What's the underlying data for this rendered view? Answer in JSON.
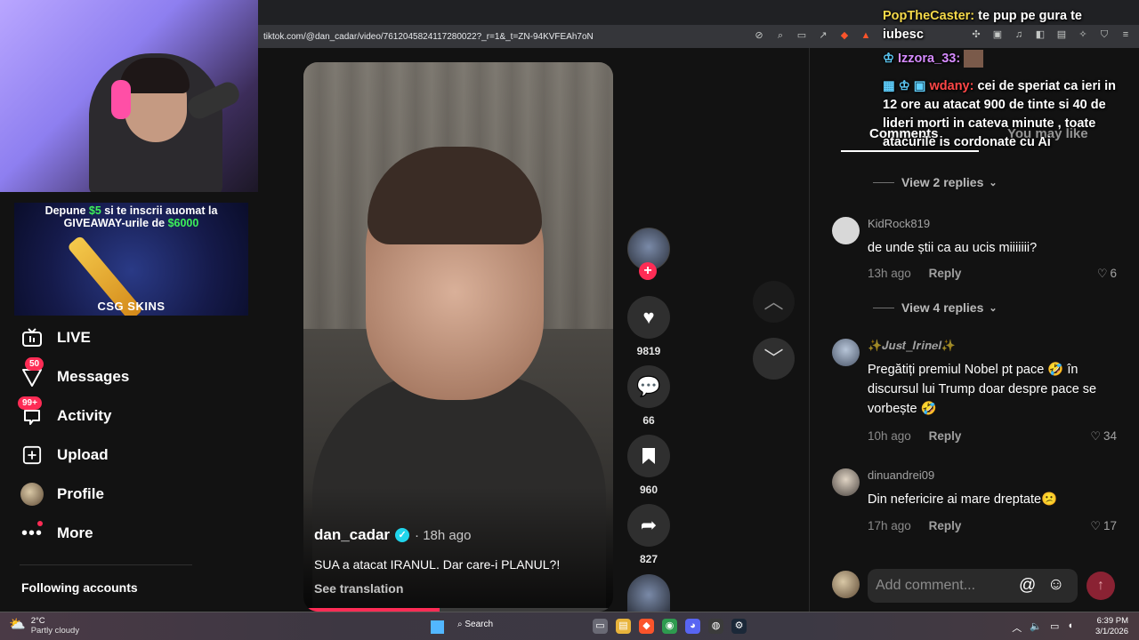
{
  "browser": {
    "url": "tiktok.com/@dan_cadar/video/7612045824117280022?_r=1&_t=ZN-94KVFEAh7oN"
  },
  "ad": {
    "line1_a": "Depune ",
    "line1_amount": "$5",
    "line1_b": " si te inscrii auomat la",
    "line2_a": "GIVEAWAY-urile de ",
    "line2_amount": "$6000",
    "brand": "CSG SKINS"
  },
  "sidebar": {
    "items": [
      {
        "label": "LIVE",
        "icon": "live-tv-icon"
      },
      {
        "label": "Messages",
        "icon": "messages-icon",
        "badge": "50"
      },
      {
        "label": "Activity",
        "icon": "activity-icon",
        "badge": "99+"
      },
      {
        "label": "Upload",
        "icon": "upload-plus-icon"
      },
      {
        "label": "Profile",
        "icon": "profile-avatar"
      },
      {
        "label": "More",
        "icon": "more-dots-icon"
      }
    ],
    "following_label": "Following accounts"
  },
  "video": {
    "author": "dan_cadar",
    "age": "18h ago",
    "caption": "SUA a atacat IRANUL. Dar care-i PLANUL?!",
    "see_translation": "See translation",
    "progress": 0.44
  },
  "actions": {
    "likes": "9819",
    "comments": "66",
    "saves": "960",
    "shares": "827"
  },
  "comments_panel": {
    "tab_comments": "Comments",
    "tab_you_may_like": "You may like",
    "view_replies_1": "View 2 replies",
    "view_replies_2": "View 4 replies",
    "items": [
      {
        "user": "KidRock819",
        "text": "de unde știi ca au ucis miiiiiii?",
        "time": "13h ago",
        "reply": "Reply",
        "likes": "6"
      },
      {
        "user": "✨𝑱𝒖𝒔𝒕_𝑰𝒓𝒊𝒏𝒆𝒍✨",
        "text": "Pregătiți premiul Nobel pt pace 🤣 în discursul lui Trump doar despre pace se vorbește 🤣",
        "time": "10h ago",
        "reply": "Reply",
        "likes": "34"
      },
      {
        "user": "dinuandrei09",
        "text": "Din nefericire ai mare dreptate😕",
        "time": "17h ago",
        "reply": "Reply",
        "likes": "17"
      }
    ],
    "add_placeholder": "Add comment..."
  },
  "chat": [
    {
      "name": "PopTheCaster:",
      "text": " te pup pe gura te iubesc"
    },
    {
      "name": "Izzora_33:",
      "text": ""
    },
    {
      "name": "wdany:",
      "text": " cei de speriat ca ieri in 12 ore au atacat 900 de tinte si 40 de lideri morti in cateva minute , toate atacurile is cordonate cu Ai"
    }
  ],
  "taskbar": {
    "temp": "2°C",
    "weather": "Partly cloudy",
    "search": "Search",
    "time": "6:39 PM",
    "date": "3/1/2026"
  }
}
